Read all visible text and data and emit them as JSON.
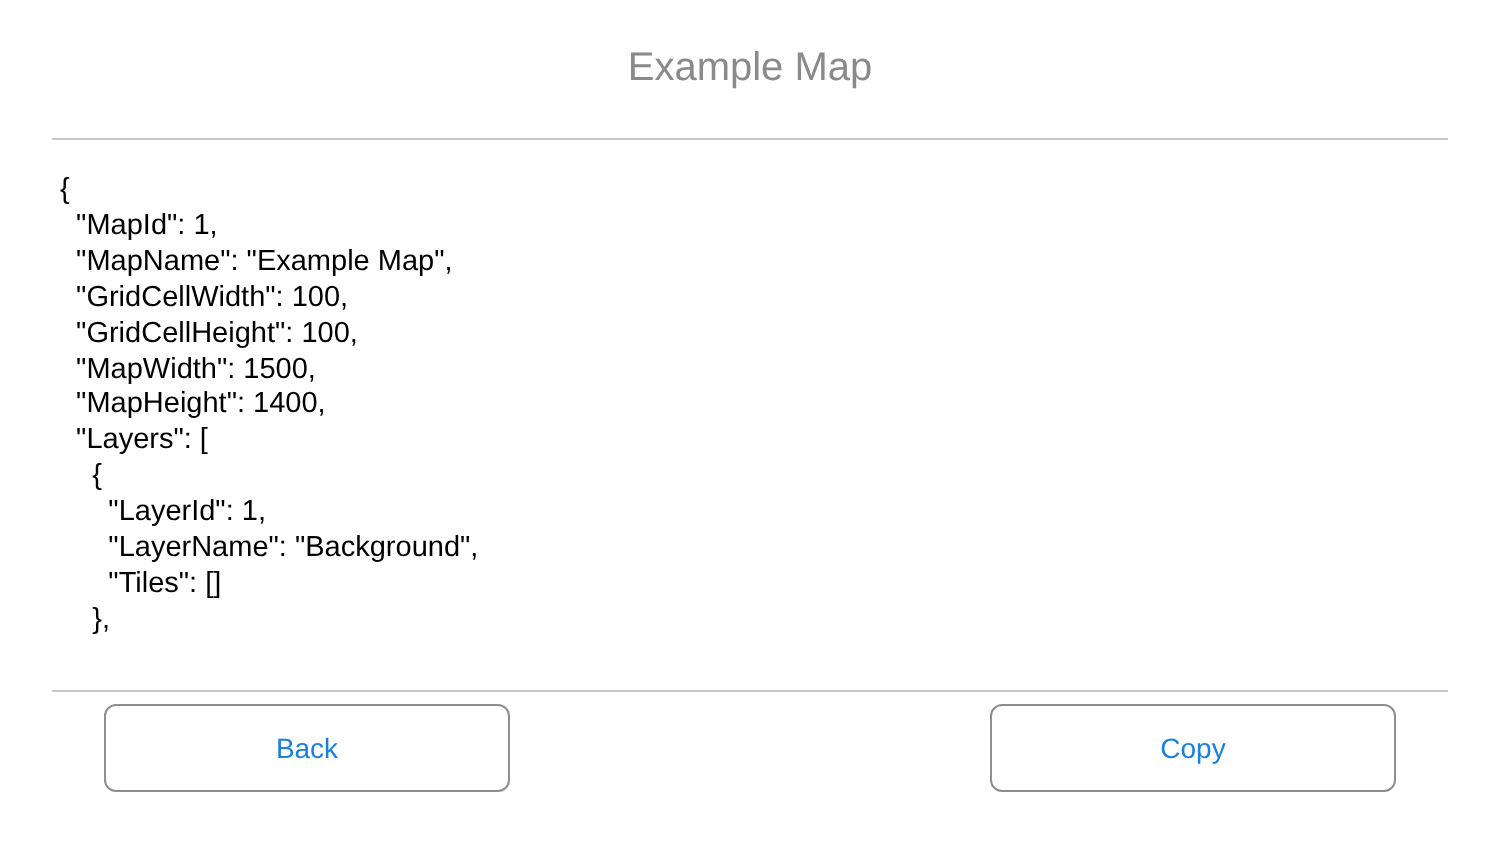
{
  "title": "Example Map",
  "json_lines": [
    "{",
    "  \"MapId\": 1,",
    "  \"MapName\": \"Example Map\",",
    "  \"GridCellWidth\": 100,",
    "  \"GridCellHeight\": 100,",
    "  \"MapWidth\": 1500,",
    "  \"MapHeight\": 1400,",
    "  \"Layers\": [",
    "    {",
    "      \"LayerId\": 1,",
    "      \"LayerName\": \"Background\",",
    "      \"Tiles\": []",
    "    },"
  ],
  "buttons": [
    {
      "label": "Back"
    },
    {
      "label": "Copy"
    }
  ]
}
